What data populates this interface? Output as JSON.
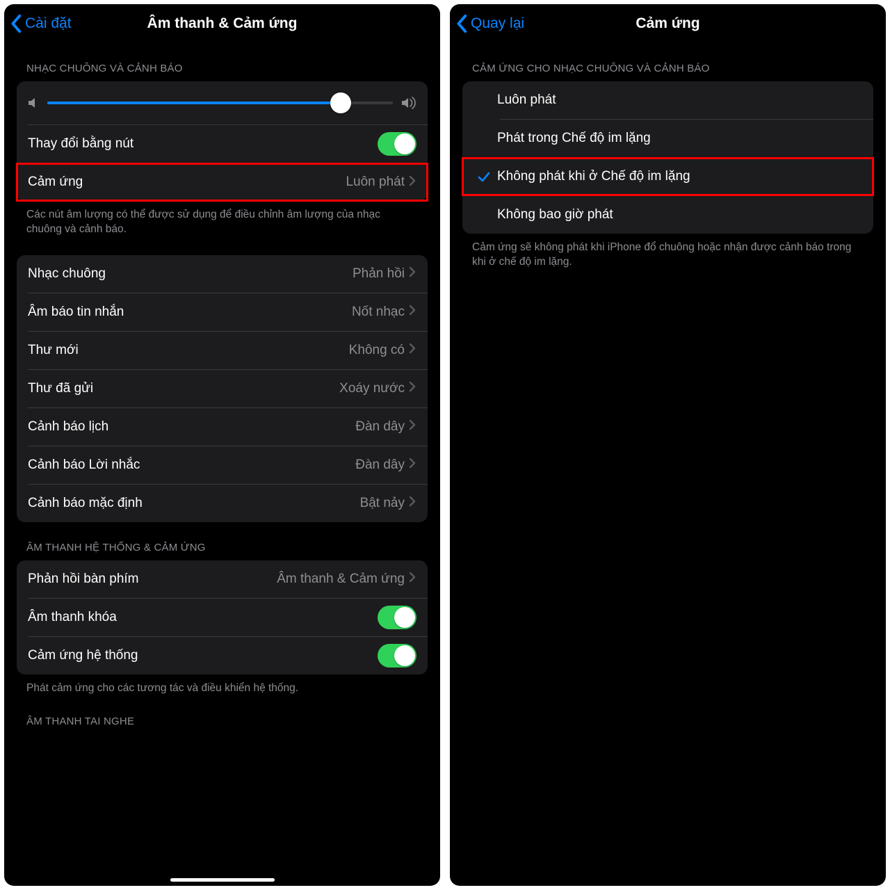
{
  "left": {
    "back": "Cài đặt",
    "title": "Âm thanh & Cảm ứng",
    "section1_header": "NHẠC CHUÔNG VÀ CẢNH BÁO",
    "slider_percent": 85,
    "change_with_buttons": "Thay đổi bằng nút",
    "haptics_label": "Cảm ứng",
    "haptics_value": "Luôn phát",
    "section1_footer": "Các nút âm lượng có thể được sử dụng để điều chỉnh âm lượng của nhạc chuông và cảnh báo.",
    "sounds": [
      {
        "label": "Nhạc chuông",
        "value": "Phản hồi"
      },
      {
        "label": "Âm báo tin nhắn",
        "value": "Nốt nhạc"
      },
      {
        "label": "Thư mới",
        "value": "Không có"
      },
      {
        "label": "Thư đã gửi",
        "value": "Xoáy nước"
      },
      {
        "label": "Cảnh báo lịch",
        "value": "Đàn dây"
      },
      {
        "label": "Cảnh báo Lời nhắc",
        "value": "Đàn dây"
      },
      {
        "label": "Cảnh báo mặc định",
        "value": "Bật nảy"
      }
    ],
    "section3_header": "ÂM THANH HỆ THỐNG & CẢM ỨNG",
    "keyboard_feedback_label": "Phản hồi bàn phím",
    "keyboard_feedback_value": "Âm thanh & Cảm ứng",
    "lock_sound": "Âm thanh khóa",
    "system_haptics": "Cảm ứng hệ thống",
    "section3_footer": "Phát cảm ứng cho các tương tác và điều khiển hệ thống.",
    "section4_header": "ÂM THANH TAI NGHE"
  },
  "right": {
    "back": "Quay lại",
    "title": "Cảm ứng",
    "section_header": "CẢM ỨNG CHO NHẠC CHUÔNG VÀ CẢNH BÁO",
    "options": [
      "Luôn phát",
      "Phát trong Chế độ im lặng",
      "Không phát khi ở Chế độ im lặng",
      "Không bao giờ phát"
    ],
    "selected_index": 2,
    "footer": "Cảm ứng sẽ không phát khi iPhone đổ chuông hoặc nhận được cảnh báo trong khi ở chế độ im lặng."
  }
}
